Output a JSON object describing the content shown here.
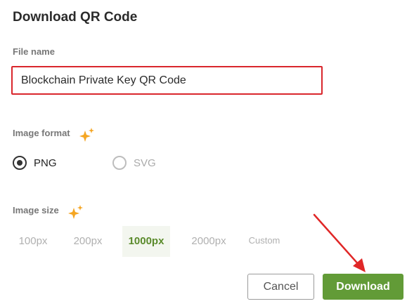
{
  "dialog": {
    "title": "Download QR Code"
  },
  "file_name": {
    "label": "File name",
    "value": "Blockchain Private Key QR Code"
  },
  "image_format": {
    "label": "Image format",
    "icon": "sparkle-icon",
    "options": [
      {
        "label": "PNG",
        "selected": true
      },
      {
        "label": "SVG",
        "selected": false
      }
    ]
  },
  "image_size": {
    "label": "Image size",
    "icon": "sparkle-icon",
    "options": [
      {
        "label": "100px",
        "selected": false
      },
      {
        "label": "200px",
        "selected": false
      },
      {
        "label": "1000px",
        "selected": true
      },
      {
        "label": "2000px",
        "selected": false
      },
      {
        "label": "Custom",
        "selected": false
      }
    ]
  },
  "actions": {
    "cancel_label": "Cancel",
    "download_label": "Download"
  },
  "colors": {
    "accent_green": "#629b37",
    "highlight_red": "#d9262c",
    "sparkle_orange": "#f5a623"
  }
}
